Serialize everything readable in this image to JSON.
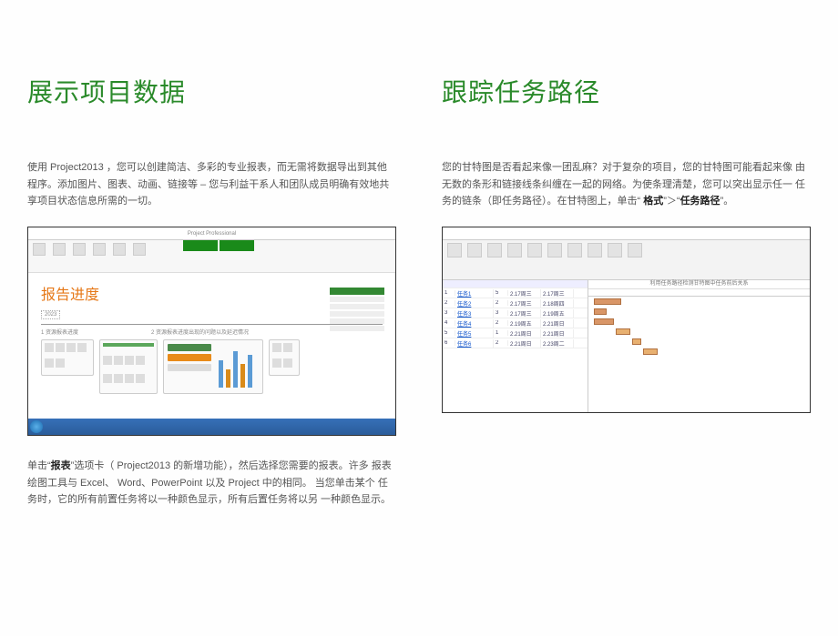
{
  "left": {
    "heading": "展示项目数据",
    "para1": "使用  Project2013 ，您可以创建简洁、多彩的专业报表，而无需将数据导出到其他  程序。添加图片、图表、动画、链接等  –  您与利益干系人和团队成员明确有效地共  享项目状态信息所需的一切。",
    "para2_pre": "单击“",
    "para2_b1": "报表",
    "para2_mid": "”选项卡（  Project2013 的新增功能），然后选择您需要的报表。许多  报表绘图工具与  Excel、 Word、PowerPoint 以及  Project 中的相同。  当您单击某个 任务时，它的所有前置任务将以一种颜色显示，所有后置任务将以另  一种颜色显示。",
    "s1": {
      "title": "报告进度",
      "titlebar": "Project Professional",
      "section_left": "1 资源报表进度",
      "section_right": "2 资源报表进度出现的问题以及延迟情况"
    }
  },
  "right": {
    "heading": "跟踪任务路径",
    "para1_pre": "您的甘特图是否看起来像一团乱麻？对于复杂的项目，您的甘特图可能看起来像  由无数的条形和链接线条纠缠在一起的网络。为使条理清楚，您可以突出显示任一  任务的链条（即任务路径）。在甘特图上，单击“",
    "para1_b1": " 格式",
    "para1_mid": "”＞“",
    "para1_b2": "任务路径",
    "para1_end": "”。",
    "s2": {
      "timescale_top": "利用任务路径检测甘特图中任务前后关系",
      "rows": [
        {
          "id": "1",
          "name": "任务1",
          "dur": "5",
          "start": "2.17周三",
          "end": "2.17周三"
        },
        {
          "id": "2",
          "name": "任务2",
          "dur": "2",
          "start": "2.17周三",
          "end": "2.18周四"
        },
        {
          "id": "3",
          "name": "任务3",
          "dur": "3",
          "start": "2.17周三",
          "end": "2.19周五"
        },
        {
          "id": "4",
          "name": "任务4",
          "dur": "2",
          "start": "2.19周五",
          "end": "2.21周日"
        },
        {
          "id": "5",
          "name": "任务5",
          "dur": "1",
          "start": "2.21周日",
          "end": "2.21周日"
        },
        {
          "id": "6",
          "name": "任务6",
          "dur": "2",
          "start": "2.21周日",
          "end": "2.23周二"
        }
      ]
    }
  }
}
